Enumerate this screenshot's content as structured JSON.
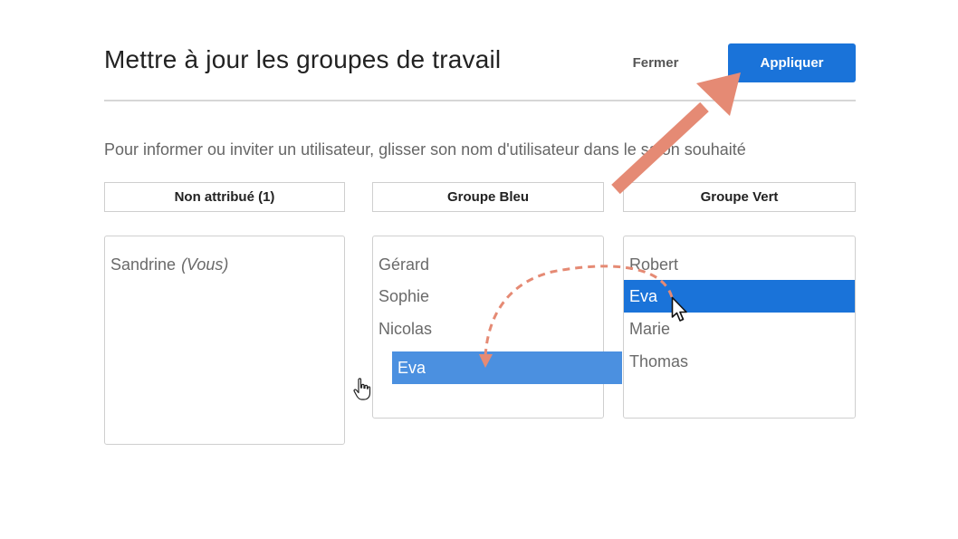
{
  "header": {
    "title": "Mettre à jour les groupes de travail",
    "close_label": "Fermer",
    "apply_label": "Appliquer"
  },
  "instruction": "Pour informer ou inviter un utilisateur, glisser son nom d'utilisateur dans le salon souhaité",
  "columns": [
    {
      "header": "Non attribué (1)",
      "items": [
        {
          "name": "Sandrine",
          "suffix": "(Vous)"
        }
      ]
    },
    {
      "header": "Groupe Bleu",
      "items": [
        {
          "name": "Gérard"
        },
        {
          "name": "Sophie"
        },
        {
          "name": "Nicolas"
        }
      ]
    },
    {
      "header": "Groupe Vert",
      "items": [
        {
          "name": "Robert"
        },
        {
          "name": "Eva",
          "selected": true
        },
        {
          "name": "Marie"
        },
        {
          "name": "Thomas"
        }
      ]
    }
  ],
  "drag_ghost_label": "Eva",
  "colors": {
    "primary": "#1a73d9",
    "drag_ghost": "#4b90e0",
    "annotation_arrow": "#e58a74"
  },
  "icons": [
    "hand-pointer-icon",
    "arrow-pointer-icon"
  ]
}
